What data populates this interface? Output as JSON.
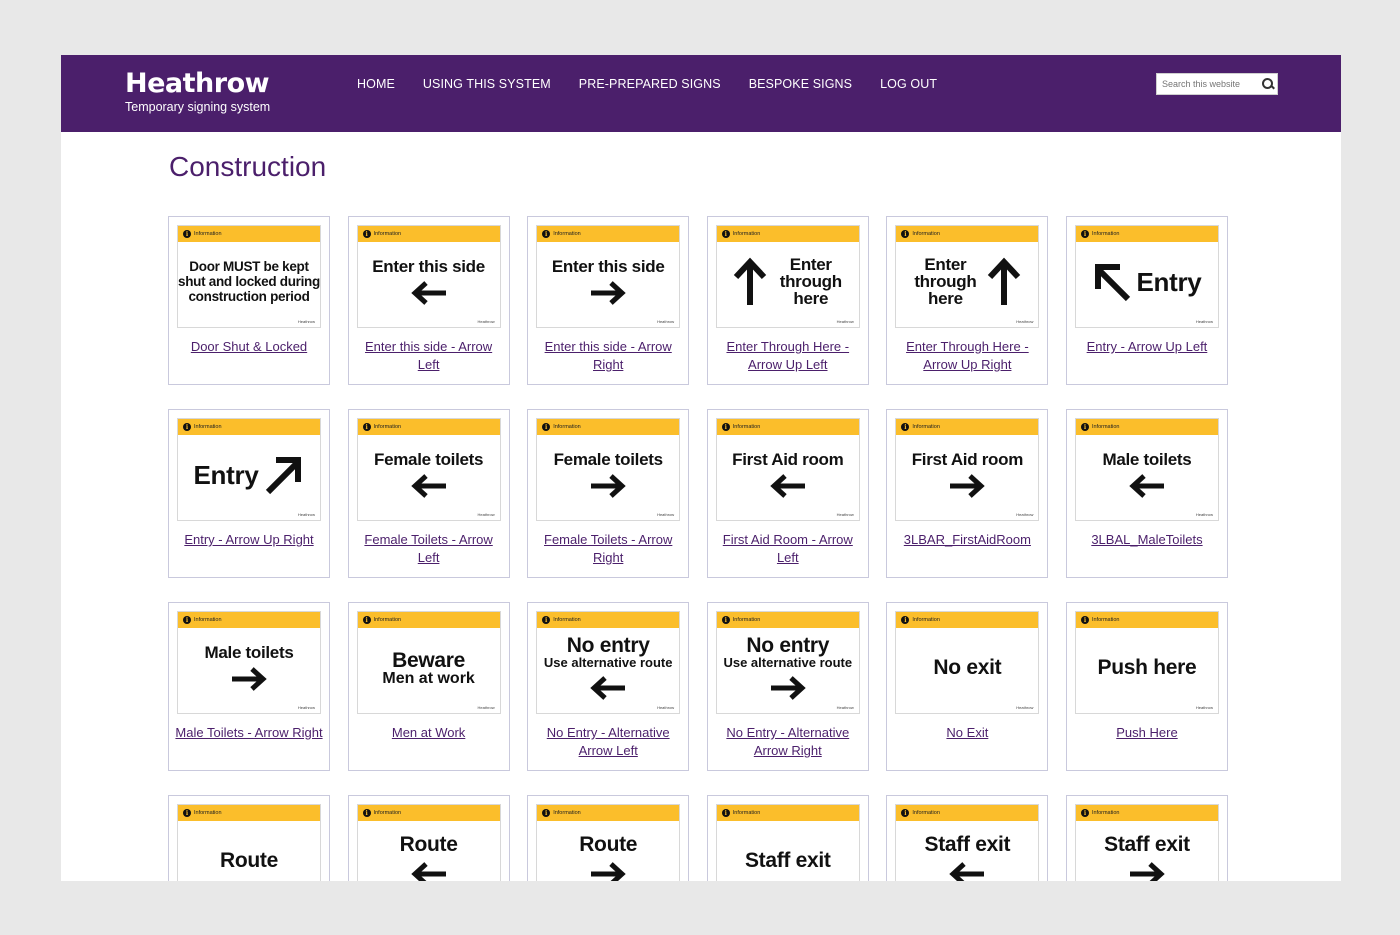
{
  "header": {
    "logo_word": "Heathrow",
    "logo_sub": "Temporary signing system",
    "nav": [
      "HOME",
      "USING THIS SYSTEM",
      "PRE-PREPARED SIGNS",
      "BESPOKE SIGNS",
      "LOG OUT"
    ],
    "search_placeholder": "Search this website"
  },
  "page_title": "Construction",
  "sign_bar_label": "Information",
  "sign_brand": "Heathrow",
  "cards": [
    {
      "main": "Door MUST be kept shut and locked during construction period",
      "caption": "Door Shut & Locked"
    },
    {
      "main": "Enter this side",
      "caption": "Enter this side - Arrow Left"
    },
    {
      "main": "Enter this side",
      "caption": "Enter this side - Arrow Right"
    },
    {
      "main": "Enter through here",
      "caption": "Enter Through Here - Arrow Up Left"
    },
    {
      "main": "Enter through here",
      "caption": "Enter Through Here - Arrow Up Right"
    },
    {
      "main": "Entry",
      "caption": "Entry - Arrow Up Left"
    },
    {
      "main": "Entry",
      "caption": "Entry - Arrow Up Right"
    },
    {
      "main": "Female toilets",
      "caption": "Female Toilets - Arrow Left"
    },
    {
      "main": "Female toilets",
      "caption": "Female Toilets - Arrow Right"
    },
    {
      "main": "First Aid room",
      "caption": "First Aid Room - Arrow Left"
    },
    {
      "main": "First Aid room",
      "caption": "3LBAR_FirstAidRoom"
    },
    {
      "main": "Male toilets",
      "caption": "3LBAL_MaleToilets"
    },
    {
      "main": "Male toilets",
      "caption": "Male Toilets - Arrow Right"
    },
    {
      "main": "Beware",
      "sub": "Men at work",
      "caption": "Men at Work"
    },
    {
      "main": "No entry",
      "sub": "Use alternative route",
      "caption": "No Entry - Alternative Arrow Left"
    },
    {
      "main": "No entry",
      "sub": "Use alternative route",
      "caption": "No Entry - Alternative Arrow Right"
    },
    {
      "main": "No exit",
      "caption": "No Exit"
    },
    {
      "main": "Push here",
      "caption": "Push Here"
    },
    {
      "main": "Route",
      "caption": ""
    },
    {
      "main": "Route",
      "caption": ""
    },
    {
      "main": "Route",
      "caption": ""
    },
    {
      "main": "Staff exit",
      "caption": ""
    },
    {
      "main": "Staff exit",
      "caption": ""
    },
    {
      "main": "Staff exit",
      "caption": ""
    }
  ]
}
